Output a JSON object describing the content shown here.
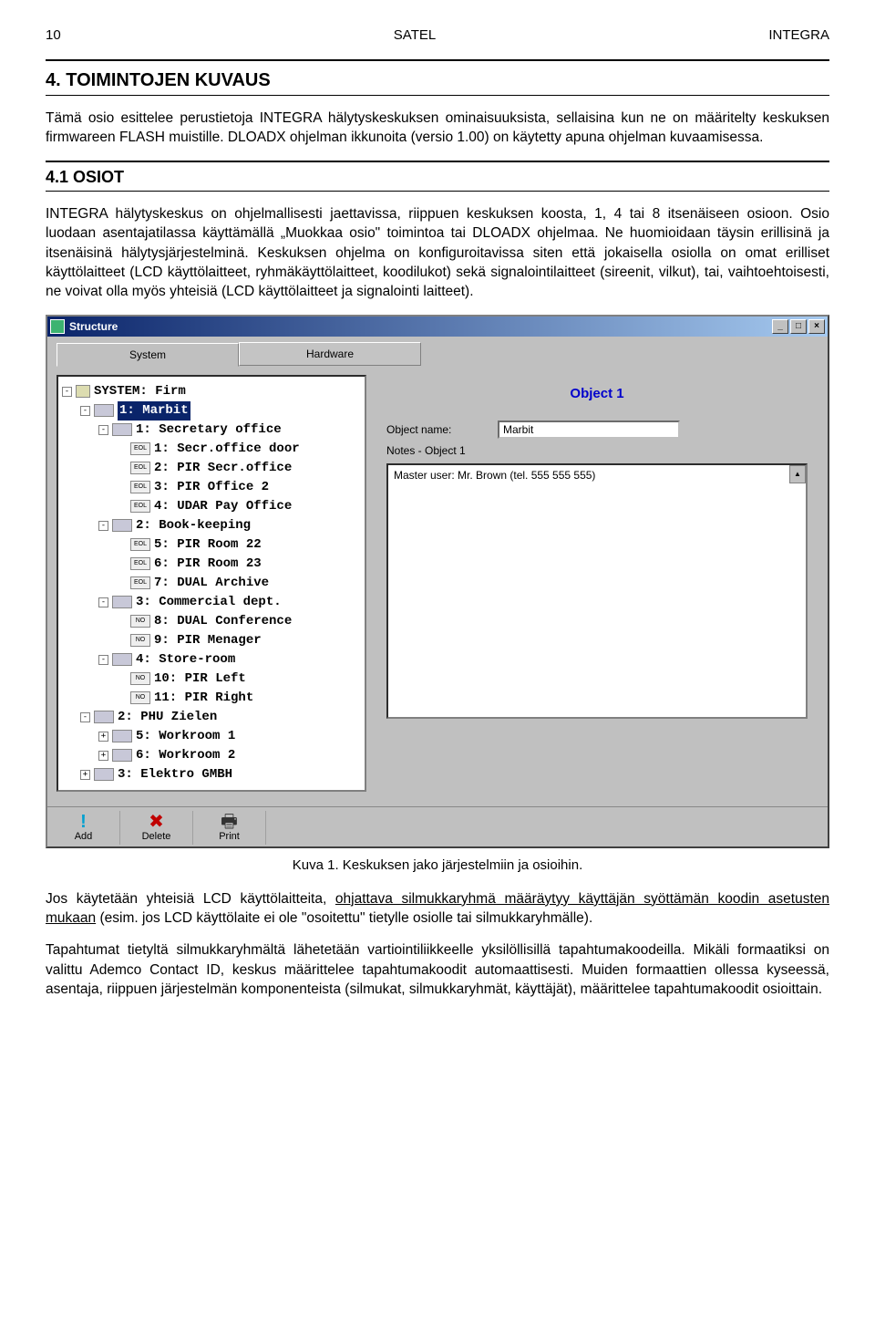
{
  "header": {
    "page_no": "10",
    "brand": "SATEL",
    "product": "INTEGRA"
  },
  "sec4_title": "4. TOIMINTOJEN KUVAUS",
  "p1": "Tämä osio esittelee perustietoja INTEGRA hälytyskeskuksen ominaisuuksista, sellaisina kun ne on määritelty keskuksen firmwareen FLASH muistille. DLOADX ohjelman ikkunoita (versio 1.00) on käytetty apuna ohjelman kuvaamisessa.",
  "sec41_title": "4.1 OSIOT",
  "p2": "INTEGRA hälytyskeskus on ohjelmallisesti jaettavissa, riippuen keskuksen koosta, 1, 4 tai 8 itsenäiseen osioon. Osio luodaan asentajatilassa käyttämällä „Muokkaa osio\" toimintoa tai DLOADX ohjelmaa. Ne huomioidaan täysin erillisinä ja itsenäisinä hälytysjärjestelminä. Keskuksen ohjelma on konfiguroitavissa siten että jokaisella osiolla on omat erilliset käyttölaitteet (LCD käyttölaitteet, ryhmäkäyttölaitteet, koodilukot) sekä signalointilaitteet (sireenit, vilkut), tai, vaihtoehtoisesti, ne voivat olla myös yhteisiä (LCD käyttölaitteet ja signalointi laitteet).",
  "win": {
    "title": "Structure",
    "tabs": {
      "system": "System",
      "hardware": "Hardware"
    },
    "tree": [
      {
        "depth": 0,
        "exp": "-",
        "icon": "pc",
        "label": "SYSTEM: Firm"
      },
      {
        "depth": 1,
        "exp": "-",
        "icon": "box",
        "label": "1: Marbit",
        "selected": true
      },
      {
        "depth": 2,
        "exp": "-",
        "icon": "box",
        "label": "1: Secretary office"
      },
      {
        "depth": 3,
        "exp": "",
        "icon": "EOL",
        "label": "1: Secr.office door"
      },
      {
        "depth": 3,
        "exp": "",
        "icon": "EOL",
        "label": "2: PIR Secr.office"
      },
      {
        "depth": 3,
        "exp": "",
        "icon": "EOL",
        "label": "3: PIR Office 2"
      },
      {
        "depth": 3,
        "exp": "",
        "icon": "EOL",
        "label": "4: UDAR Pay Office"
      },
      {
        "depth": 2,
        "exp": "-",
        "icon": "box",
        "label": "2: Book-keeping"
      },
      {
        "depth": 3,
        "exp": "",
        "icon": "EOL",
        "label": "5: PIR Room 22"
      },
      {
        "depth": 3,
        "exp": "",
        "icon": "EOL",
        "label": "6: PIR Room 23"
      },
      {
        "depth": 3,
        "exp": "",
        "icon": "EOL",
        "label": "7: DUAL Archive"
      },
      {
        "depth": 2,
        "exp": "-",
        "icon": "box",
        "label": "3: Commercial dept."
      },
      {
        "depth": 3,
        "exp": "",
        "icon": "NO",
        "label": "8: DUAL Conference"
      },
      {
        "depth": 3,
        "exp": "",
        "icon": "NO",
        "label": "9: PIR Menager"
      },
      {
        "depth": 2,
        "exp": "-",
        "icon": "box",
        "label": "4: Store-room"
      },
      {
        "depth": 3,
        "exp": "",
        "icon": "NO",
        "label": "10: PIR Left"
      },
      {
        "depth": 3,
        "exp": "",
        "icon": "NO",
        "label": "11: PIR Right"
      },
      {
        "depth": 1,
        "exp": "-",
        "icon": "box",
        "label": "2: PHU Zielen"
      },
      {
        "depth": 2,
        "exp": "+",
        "icon": "box",
        "label": "5: Workroom 1"
      },
      {
        "depth": 2,
        "exp": "+",
        "icon": "box",
        "label": "6: Workroom 2"
      },
      {
        "depth": 1,
        "exp": "+",
        "icon": "box",
        "label": "3: Elektro GMBH"
      }
    ],
    "right": {
      "heading": "Object 1",
      "name_label": "Object name:",
      "name_value": "Marbit",
      "notes_label": "Notes - Object 1",
      "notes_value": "Master user: Mr. Brown (tel. 555 555 555)"
    },
    "toolbar": {
      "add": "Add",
      "delete": "Delete",
      "print": "Print"
    }
  },
  "caption": "Kuva 1. Keskuksen jako järjestelmiin ja osioihin.",
  "p3a": "Jos käytetään yhteisiä LCD käyttölaitteita, ",
  "p3u": "ohjattava silmukkaryhmä määräytyy käyttäjän syöttämän koodin asetusten mukaan",
  "p3b": " (esim. jos LCD käyttölaite ei ole \"osoitettu\" tietylle osiolle tai silmukkaryhmälle).",
  "p4": "Tapahtumat tietyltä silmukkaryhmältä lähetetään vartiointiliikkeelle yksilöllisillä tapahtumakoodeilla. Mikäli formaatiksi on valittu Ademco Contact ID, keskus määrittelee tapahtumakoodit automaattisesti. Muiden formaattien ollessa kyseessä, asentaja, riippuen järjestelmän komponenteista (silmukat, silmukkaryhmät, käyttäjät), määrittelee tapahtumakoodit osioittain."
}
